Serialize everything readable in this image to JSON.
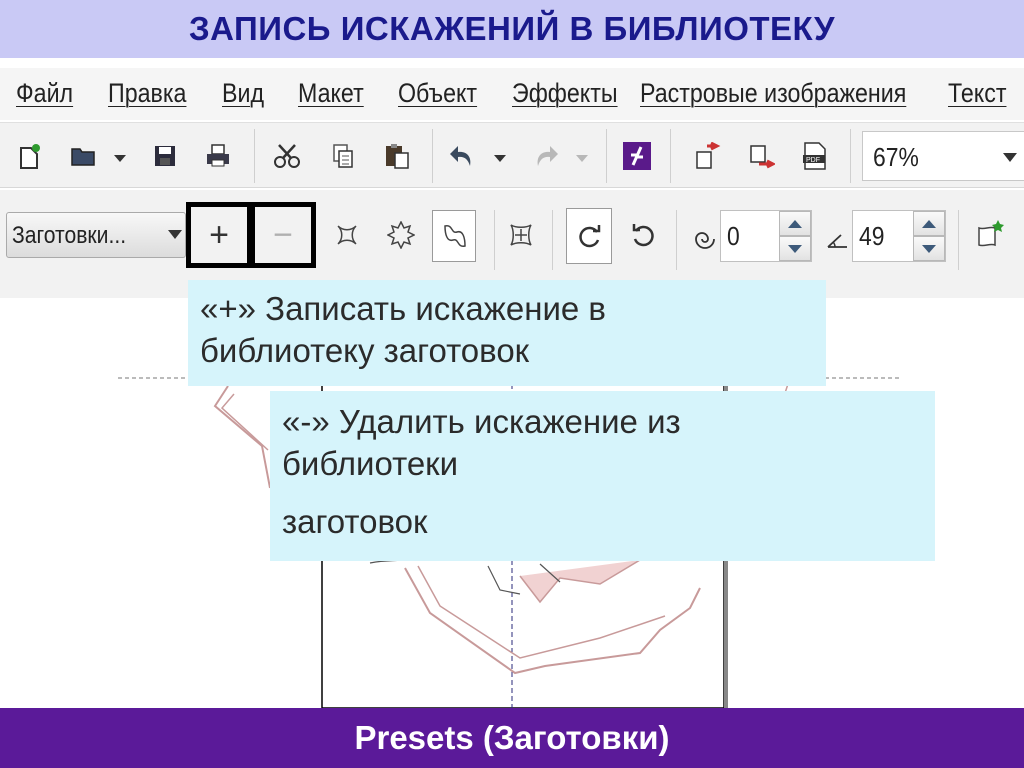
{
  "slide": {
    "title": "ЗАПИСЬ ИСКАЖЕНИЙ В БИБЛИОТЕКУ",
    "footer": "Presets (Заготовки)"
  },
  "menu": {
    "items": [
      {
        "label": "Файл"
      },
      {
        "label": "Правка"
      },
      {
        "label": "Вид"
      },
      {
        "label": "Макет"
      },
      {
        "label": "Объект"
      },
      {
        "label": "Эффекты"
      },
      {
        "label": "Растровые изображения"
      },
      {
        "label": "Текст"
      }
    ]
  },
  "toolbar": {
    "zoom": "67%"
  },
  "property_bar": {
    "preset_select": "Заготовки...",
    "add_preset": "+",
    "remove_preset": "−",
    "rotation_value": "0",
    "angle_value": "49"
  },
  "callouts": {
    "add": {
      "line1": "«+» Записать искажение в",
      "line2": "библиотеку заготовок"
    },
    "remove": {
      "line1": "«-» Удалить искажение из",
      "line2": "библиотеки",
      "line3": "заготовок"
    }
  },
  "colors": {
    "title_bg": "#c9c9f5",
    "title_text": "#1a1a8c",
    "footer_bg": "#5b1a99",
    "callout_bg": "#d6f4fb",
    "shape_stroke": "#c89a9a"
  },
  "icons": [
    "new-doc-icon",
    "open-folder-icon",
    "save-icon",
    "print-icon",
    "cut-icon",
    "copy-icon",
    "paste-icon",
    "undo-icon",
    "redo-icon",
    "launcher-icon",
    "import-icon",
    "export-icon",
    "pdf-export-icon",
    "push-pull-distortion-icon",
    "zipper-distortion-icon",
    "twister-distortion-icon",
    "center-distortion-icon",
    "rotate-clockwise-icon",
    "rotate-counterclockwise-icon",
    "amplitude-icon",
    "angle-icon",
    "copy-distortion-icon"
  ]
}
